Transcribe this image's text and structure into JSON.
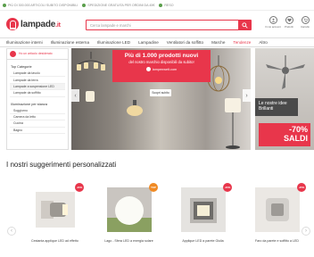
{
  "topbar": {
    "items": [
      "PIÙ DI 300.000 ARTICOLI SUBITO DISPONIBILI",
      "SPEDIZIONE GRATUITA PER ORDINI DA 45€",
      "RESO"
    ]
  },
  "header": {
    "logo_text": "lampade",
    "logo_suffix": ".it",
    "search": {
      "placeholder": "Cerca lampade e marchi",
      "button_icon": "search-icon"
    },
    "icons": [
      {
        "name": "user-icon",
        "label": "Il mio account"
      },
      {
        "name": "heart-icon",
        "label": "Preferiti"
      },
      {
        "name": "cart-icon",
        "label": "Carrello"
      }
    ]
  },
  "nav": {
    "items": [
      {
        "label": "Illuminazione interni",
        "highlight": false
      },
      {
        "label": "Illuminazione esterna",
        "highlight": false
      },
      {
        "label": "Illuminazione LED",
        "highlight": false
      },
      {
        "label": "Lampadine",
        "highlight": false
      },
      {
        "label": "Ventilatori da soffitto",
        "highlight": false
      },
      {
        "label": "Marche",
        "highlight": false
      },
      {
        "label": "Tendenze",
        "highlight": true
      },
      {
        "label": "Altro",
        "highlight": false
      }
    ]
  },
  "sidebar": {
    "header": "Ho un articolo desiderato",
    "section_title": "Top Categorie",
    "categories": [
      "Lampade da tavolo",
      "Lampade da terra",
      "Lampade a sospensione LED",
      "Lampade da soffitto"
    ],
    "section2_title": "Illuminazione per stanza",
    "rooms": [
      "Soggiorno",
      "Camera da letto",
      "Cucina",
      "Bagno"
    ]
  },
  "hero": {
    "headline": "Più di 1.000 prodotti nuovi",
    "subline": "del nostro marchio disponibili da subito!",
    "brand": "lampenwelt.com",
    "cta": "Scopri subito"
  },
  "right_panel": {
    "tag_line1": "Le nostre idee",
    "tag_line2": "Brillanti",
    "sale_pct": "-70%",
    "sale_text": "SALDI"
  },
  "recommendations": {
    "title": "I nostri suggerimenti personalizzati",
    "items": [
      {
        "name": "Cestanta applique LED ad effetto",
        "badge": "-30%",
        "badge_color": "#e8364b"
      },
      {
        "name": "Lago - Sfera LED a energia solare",
        "badge": "TOP",
        "badge_color": "#f08a24"
      },
      {
        "name": "Applique LED a parete Giulia",
        "badge": "-20%",
        "badge_color": "#e8364b"
      },
      {
        "name": "Faro da parete e soffitto a LED",
        "badge": "-25%",
        "badge_color": "#e8364b"
      }
    ]
  },
  "colors": {
    "brand_red": "#e8364b",
    "badge_orange": "#f08a24"
  }
}
